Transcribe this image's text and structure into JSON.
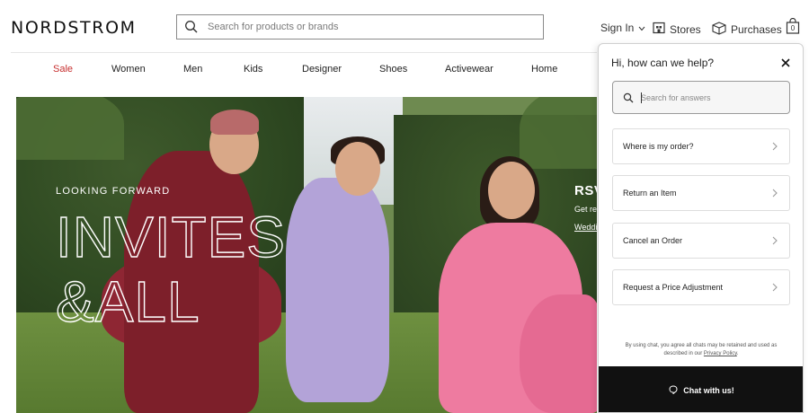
{
  "header": {
    "logo": "NORDSTROM",
    "search_placeholder": "Search for products or brands",
    "sign_in": "Sign In",
    "stores": "Stores",
    "purchases": "Purchases",
    "bag_count": "0"
  },
  "nav": {
    "items": [
      "Sale",
      "Women",
      "Men",
      "Kids",
      "Designer",
      "Shoes",
      "Activewear",
      "Home"
    ]
  },
  "hero": {
    "kicker": "LOOKING FORWARD",
    "headline_line1": "INVITES",
    "headline_line2": "&ALL",
    "side_title": "RSV",
    "side_sub": "Get re",
    "side_link": "Weddi"
  },
  "chat": {
    "title": "Hi, how can we help?",
    "search_placeholder": "Search for answers",
    "options": [
      "Where is my order?",
      "Return an Item",
      "Cancel an Order",
      "Request a Price Adjustment"
    ],
    "disclaimer_line1": "By using chat, you agree all chats may be retained and used as",
    "disclaimer_prefix": "described in our ",
    "privacy_link": "Privacy Policy",
    "disclaimer_suffix": ".",
    "chat_button": "Chat with us!"
  },
  "colors": {
    "sale": "#c73030",
    "chat_button_bg": "#111111"
  },
  "icons": {
    "search": "search-icon",
    "stores": "store-icon",
    "purchases": "package-icon",
    "bag": "shopping-bag-icon",
    "close": "close-icon",
    "chevron": "chevron-right-icon",
    "chat_bubble": "chat-bubble-icon",
    "dropdown": "chevron-down-icon"
  }
}
